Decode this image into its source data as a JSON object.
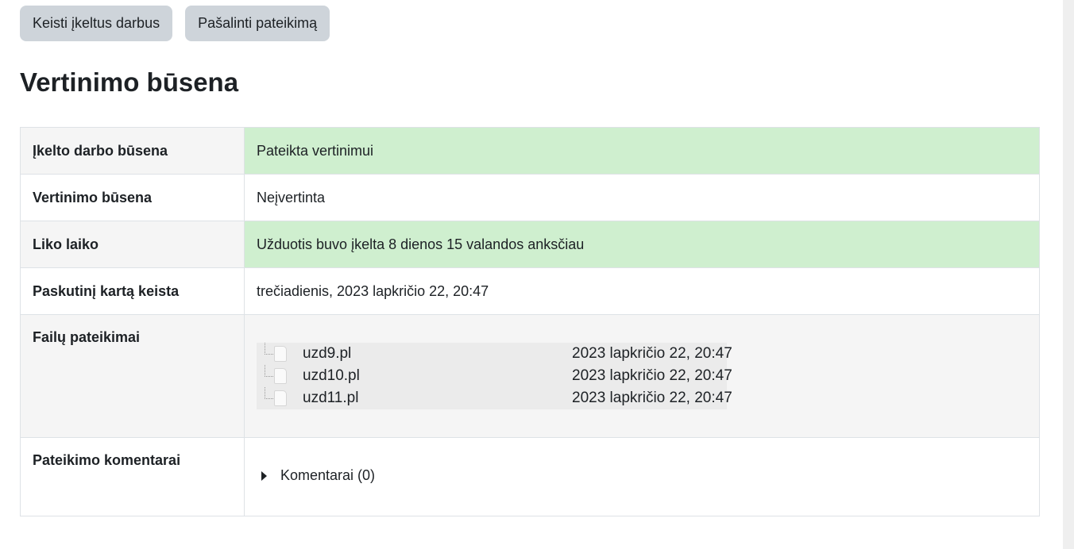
{
  "buttons": {
    "edit_submission": "Keisti įkeltus darbus",
    "remove_submission": "Pašalinti pateikimą"
  },
  "heading": "Vertinimo būsena",
  "rows": {
    "submission_status": {
      "label": "Įkelto darbo būsena",
      "value": "Pateikta vertinimui"
    },
    "grading_status": {
      "label": "Vertinimo būsena",
      "value": "Neįvertinta"
    },
    "time_remaining": {
      "label": "Liko laiko",
      "value": "Užduotis buvo įkelta 8 dienos 15 valandos anksčiau"
    },
    "last_modified": {
      "label": "Paskutinį kartą keista",
      "value": "trečiadienis, 2023 lapkričio 22, 20:47"
    },
    "file_submissions": {
      "label": "Failų pateikimai",
      "files": [
        {
          "name": "uzd9.pl",
          "date": "2023 lapkričio 22, 20:47"
        },
        {
          "name": "uzd10.pl",
          "date": "2023 lapkričio 22, 20:47"
        },
        {
          "name": "uzd11.pl",
          "date": "2023 lapkričio 22, 20:47"
        }
      ]
    },
    "submission_comments": {
      "label": "Pateikimo komentarai",
      "toggle": "Komentarai (0)"
    }
  },
  "colors": {
    "success_bg": "#cfefcf",
    "button_bg": "#ced4da"
  }
}
